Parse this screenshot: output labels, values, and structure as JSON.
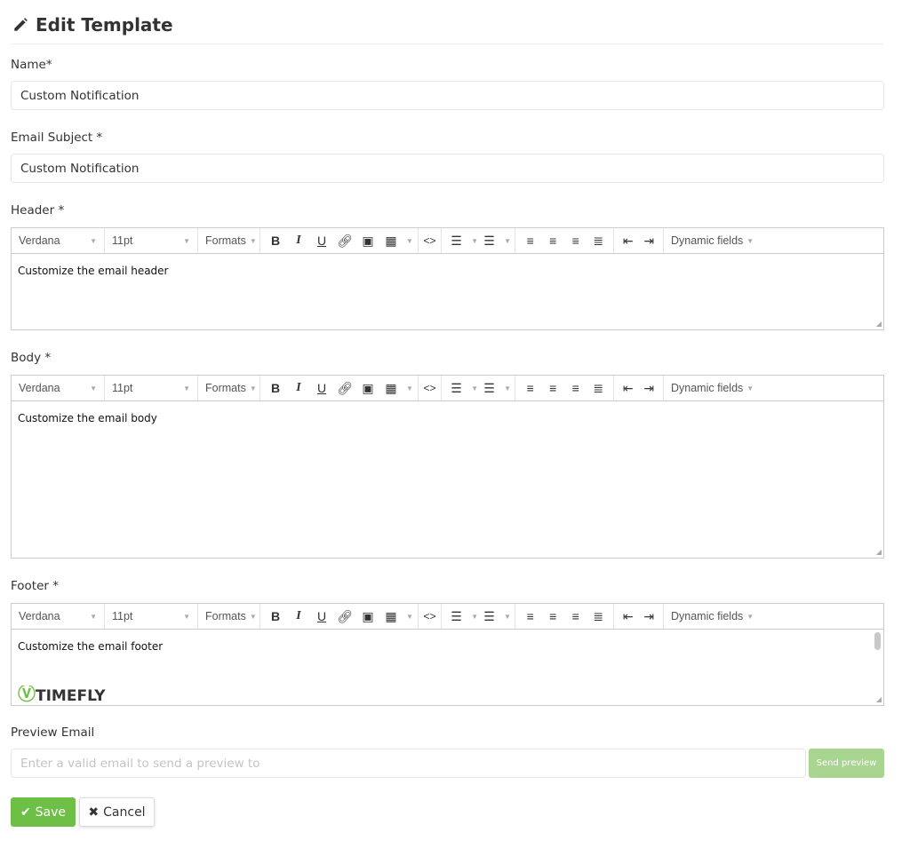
{
  "page": {
    "title": "Edit Template",
    "title_icon": "pencil-icon"
  },
  "name": {
    "label": "Name*",
    "value": "Custom Notification"
  },
  "subject": {
    "label": "Email Subject *",
    "value": "Custom Notification"
  },
  "toolbar": {
    "font": "Verdana",
    "size": "11pt",
    "formats": "Formats",
    "dynamic": "Dynamic fields",
    "bold": "B",
    "italic": "I",
    "underline": "U",
    "code": "<>"
  },
  "editors": [
    {
      "label": "Header *",
      "content": "Customize the email header"
    },
    {
      "label": "Body *",
      "content": "Customize the email body"
    },
    {
      "label": "Footer *",
      "content": "Customize the email footer",
      "logo": "TIMELY"
    }
  ],
  "preview": {
    "label": "Preview Email",
    "placeholder": "Enter a valid email to send a preview to",
    "button": "Send preview"
  },
  "actions": {
    "save": "Save",
    "cancel": "Cancel"
  },
  "colors": {
    "primary": "#6ebf45",
    "preview_button": "#a8d590"
  }
}
